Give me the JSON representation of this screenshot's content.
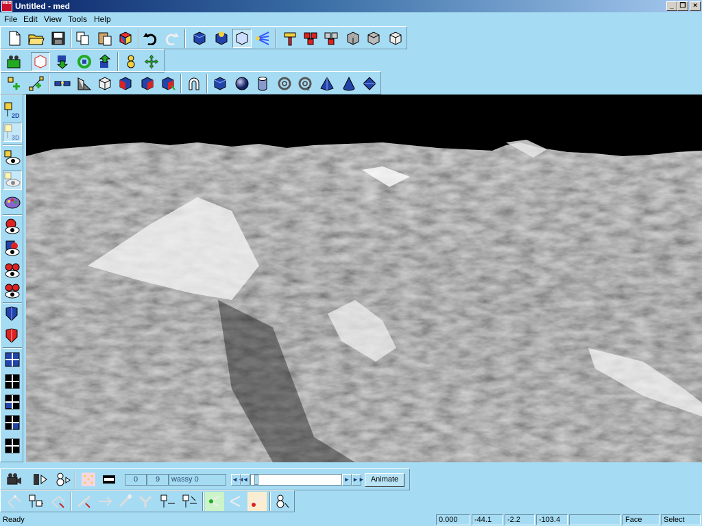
{
  "titlebar": {
    "title": "Untitled - med",
    "app_icon_text": "MED"
  },
  "menu": [
    "File",
    "Edit",
    "View",
    "Tools",
    "Help"
  ],
  "toolbar1": {
    "buttons": [
      "new-file-icon",
      "open-folder-icon",
      "save-disk-icon",
      "copy-icon",
      "paste-icon",
      "3d-cube-color-icon",
      "undo-icon",
      "redo-icon",
      "cube-blue-icon",
      "cube-light-icon",
      "cube-select-icon",
      "light-rays-icon",
      "hammer-icon",
      "red-cubes-icon",
      "mixed-cubes-icon",
      "gray-cube-icon",
      "gray-cube-2-icon",
      "white-cube-icon"
    ]
  },
  "toolbar2": {
    "buttons": [
      "camera-green-icon",
      "select-box-icon",
      "arrow-down-icon",
      "rotate-icon",
      "arrow-up-icon",
      "snowman-icon",
      "move-cross-icon"
    ]
  },
  "toolbar3": {
    "buttons": [
      "add-vertex-icon",
      "add-edge-icon",
      "glasses-icon",
      "wedge-icon",
      "box-white-icon",
      "cube-red-left-icon",
      "cube-red-right-icon",
      "cube-red-top-icon",
      "magnet-icon",
      "box-primitive-icon",
      "sphere-primitive-icon",
      "cylinder-primitive-icon",
      "torus-primitive-icon",
      "torus-2-primitive-icon",
      "pyramid-primitive-icon",
      "cone-primitive-icon",
      "diamond-primitive-icon"
    ]
  },
  "left_toolbar": {
    "label_2d": "2D",
    "label_3d": "3D"
  },
  "animbar": {
    "start_frame": "0",
    "end_frame": "9",
    "animation_name": "wassy 0",
    "slider_position": 0.04,
    "animate_label": "Animate",
    "rewind_label": "◄◄",
    "step_back_label": "◄",
    "step_forward_label": "►",
    "forward_label": "►►"
  },
  "status": {
    "ready": "Ready",
    "value1": "0.000",
    "x": "-44.1",
    "y": "-2.2",
    "z": "-103.4",
    "empty": "",
    "mode": "Face",
    "tool": "Select"
  },
  "colors": {
    "background": "#a6dcf3",
    "titlebar": "#0a246a",
    "sky": "#000000"
  }
}
